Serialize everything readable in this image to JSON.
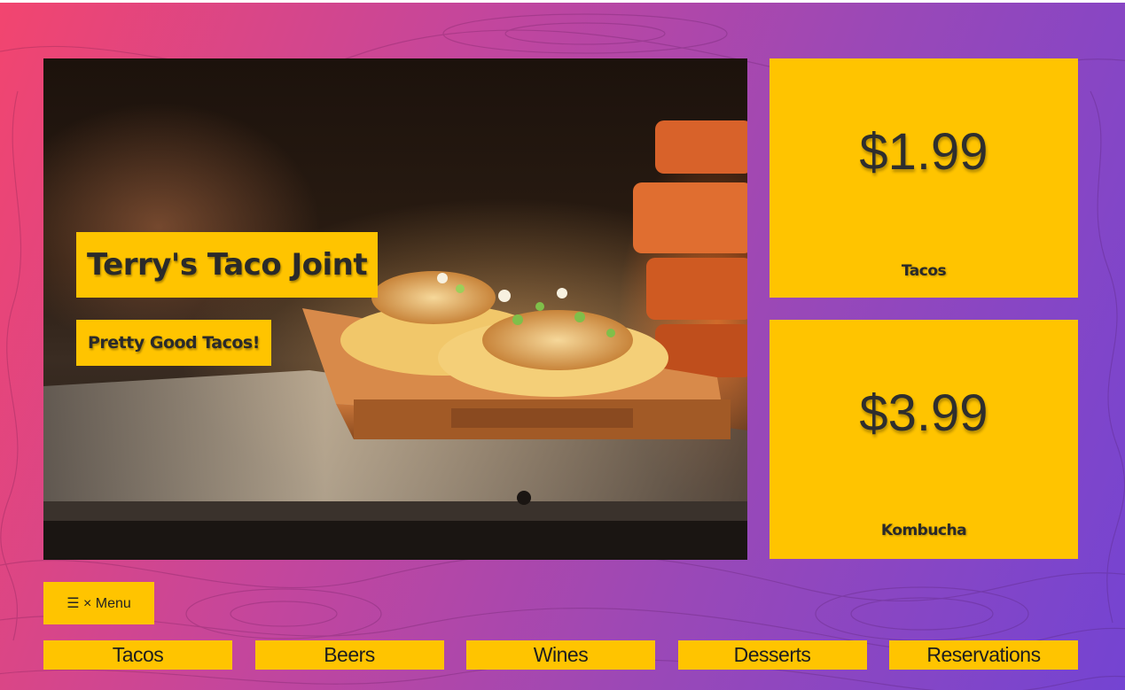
{
  "hero": {
    "title": "Terry's Taco Joint",
    "tagline": "Pretty Good Tacos!"
  },
  "specials": [
    {
      "price": "$1.99",
      "item": "Tacos"
    },
    {
      "price": "$3.99",
      "item": "Kombucha"
    }
  ],
  "menu_toggle": {
    "label": "☰ × Menu"
  },
  "nav": [
    {
      "label": "Tacos"
    },
    {
      "label": "Beers"
    },
    {
      "label": "Wines"
    },
    {
      "label": "Desserts"
    },
    {
      "label": "Reservations"
    }
  ],
  "colors": {
    "accent": "#ffc400",
    "gradient_start": "#f2456f",
    "gradient_end": "#7444d2",
    "text": "#2a2a2a"
  }
}
